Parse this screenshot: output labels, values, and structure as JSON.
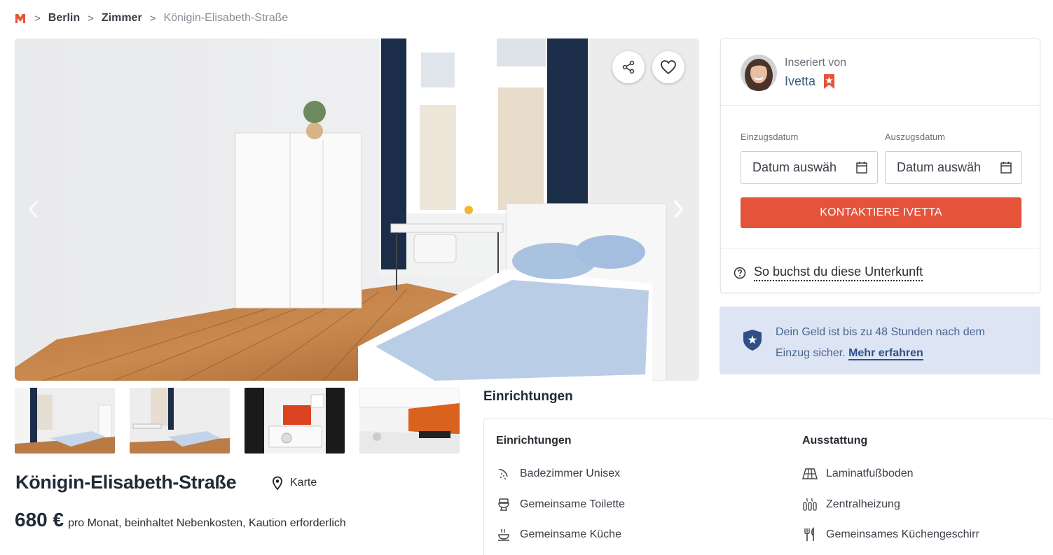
{
  "breadcrumb": {
    "logo_icon": "brand-logo-icon",
    "items": [
      "Berlin",
      "Zimmer",
      "Königin-Elisabeth-Straße"
    ],
    "separator": ">"
  },
  "gallery": {
    "share_icon": "share-icon",
    "favorite_icon": "heart-icon",
    "prev_icon": "chevron-left-icon",
    "next_icon": "chevron-right-icon",
    "thumbnail_count": 4
  },
  "listing": {
    "title": "Königin-Elisabeth-Straße",
    "map_label": "Karte",
    "price": "680 €",
    "price_info": "pro Monat, beinhaltet Nebenkosten, Kaution erforderlich"
  },
  "host": {
    "label": "Inseriert von",
    "name": "Ivetta",
    "badge_icon": "bookmark-star-icon"
  },
  "booking": {
    "move_in_label": "Einzugsdatum",
    "move_out_label": "Auszugsdatum",
    "move_in_value": "Datum auswäh",
    "move_out_value": "Datum auswäh",
    "contact_button": "KONTAKTIERE IVETTA",
    "how_to_book": "So buchst du diese Unterkunft"
  },
  "protection": {
    "text": "Dein Geld ist bis zu 48 Stunden nach dem Einzug sicher.",
    "link": "Mehr erfahren"
  },
  "amenities": {
    "section_title": "Einrichtungen",
    "col1_title": "Einrichtungen",
    "col2_title": "Ausstattung",
    "col1": [
      "Badezimmer Unisex",
      "Gemeinsame Toilette",
      "Gemeinsame Küche"
    ],
    "col2": [
      "Laminatfußboden",
      "Zentralheizung",
      "Gemeinsames Küchengeschirr"
    ]
  },
  "colors": {
    "accent": "#e5533b",
    "info_bg": "#dde4f4",
    "info_text": "#48668e"
  }
}
